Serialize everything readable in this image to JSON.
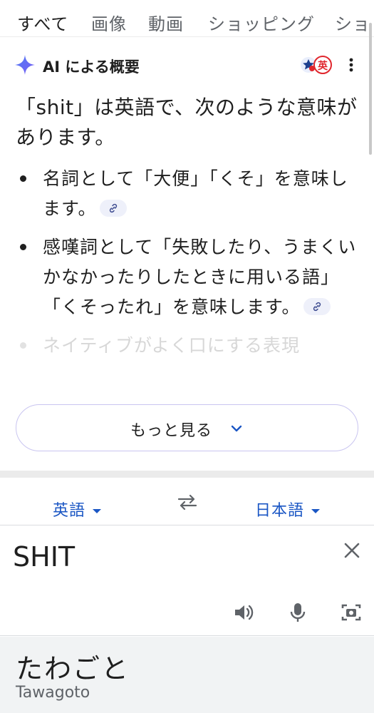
{
  "tabs": [
    "すべて",
    "画像",
    "動画",
    "ショッピング",
    "ショ"
  ],
  "ai_overview": {
    "title": "AI による概要",
    "lead": "「shit」は英語で、次のような意味があります。",
    "bullets": [
      "名詞として「大便」「くそ」を意味します。",
      "感嘆詞として「失敗したり、うまくいかなかったりしたときに用いる語」「くそったれ」を意味します。",
      "ネイティブがよく口にする表現"
    ],
    "more_label": "もっと見る",
    "accent_color": "#4e7cf6"
  },
  "translate": {
    "source_lang": "英語",
    "target_lang": "日本語",
    "input_text": "SHIT",
    "output_text": "たわごと",
    "romanization": "Tawagoto",
    "icons": [
      "swap-icon",
      "clear-icon",
      "speaker-icon",
      "mic-icon",
      "camera-icon"
    ],
    "link_color": "#1a56c4"
  }
}
